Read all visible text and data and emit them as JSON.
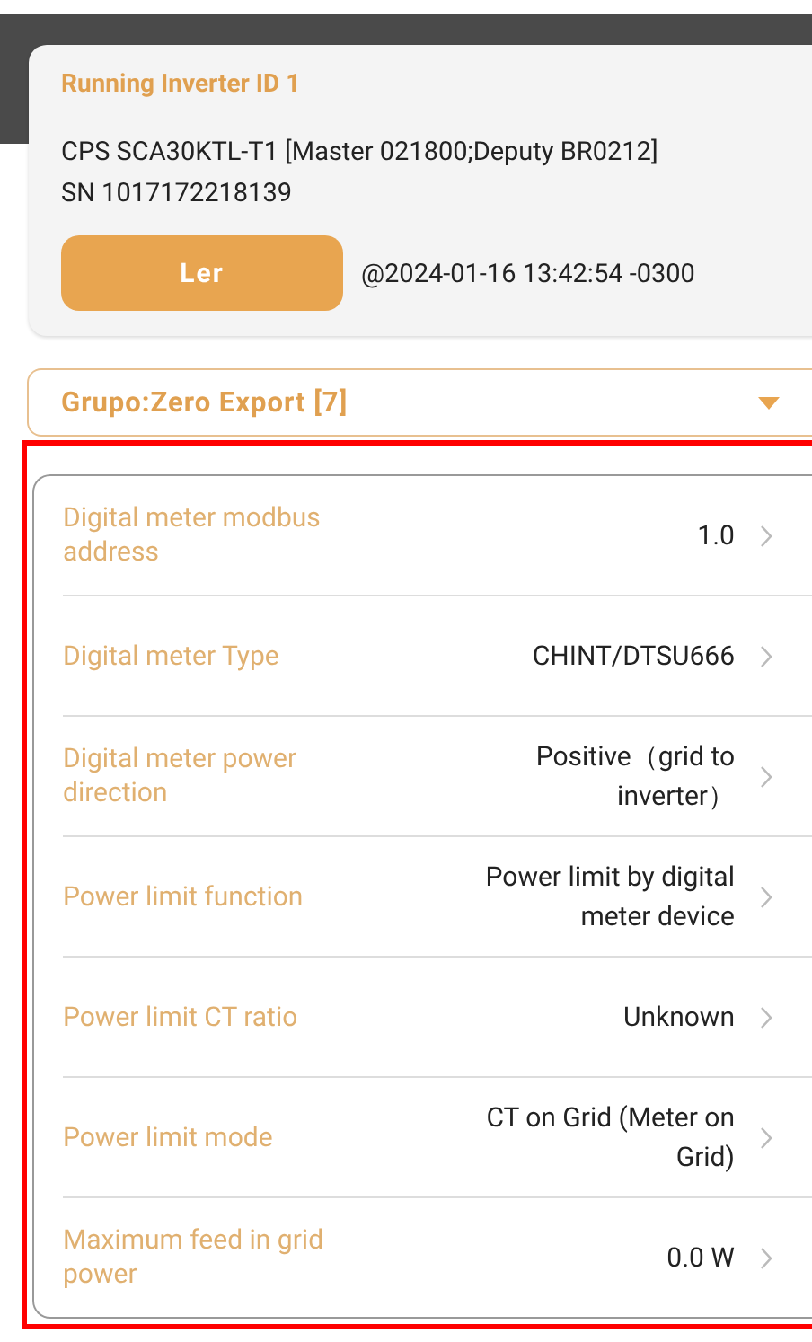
{
  "inverter_card": {
    "title": "Running Inverter ID 1",
    "model": "CPS SCA30KTL-T1 [Master 021800;Deputy BR0212]",
    "serial": "SN 1017172218139",
    "read_button": "Ler",
    "timestamp": "@2024-01-16 13:42:54 -0300"
  },
  "group_dropdown": {
    "value": "Grupo:Zero Export [7]"
  },
  "settings": [
    {
      "label": "Digital meter modbus address",
      "value": "1.0"
    },
    {
      "label": "Digital meter Type",
      "value": "CHINT/DTSU666"
    },
    {
      "label": "Digital meter power direction",
      "value": "Positive（grid to inverter）"
    },
    {
      "label": "Power limit function",
      "value": "Power limit by digital meter device"
    },
    {
      "label": "Power limit CT ratio",
      "value": "Unknown"
    },
    {
      "label": "Power limit mode",
      "value": "CT on Grid (Meter on Grid)"
    },
    {
      "label": "Maximum feed in grid power",
      "value": "0.0 W"
    }
  ]
}
